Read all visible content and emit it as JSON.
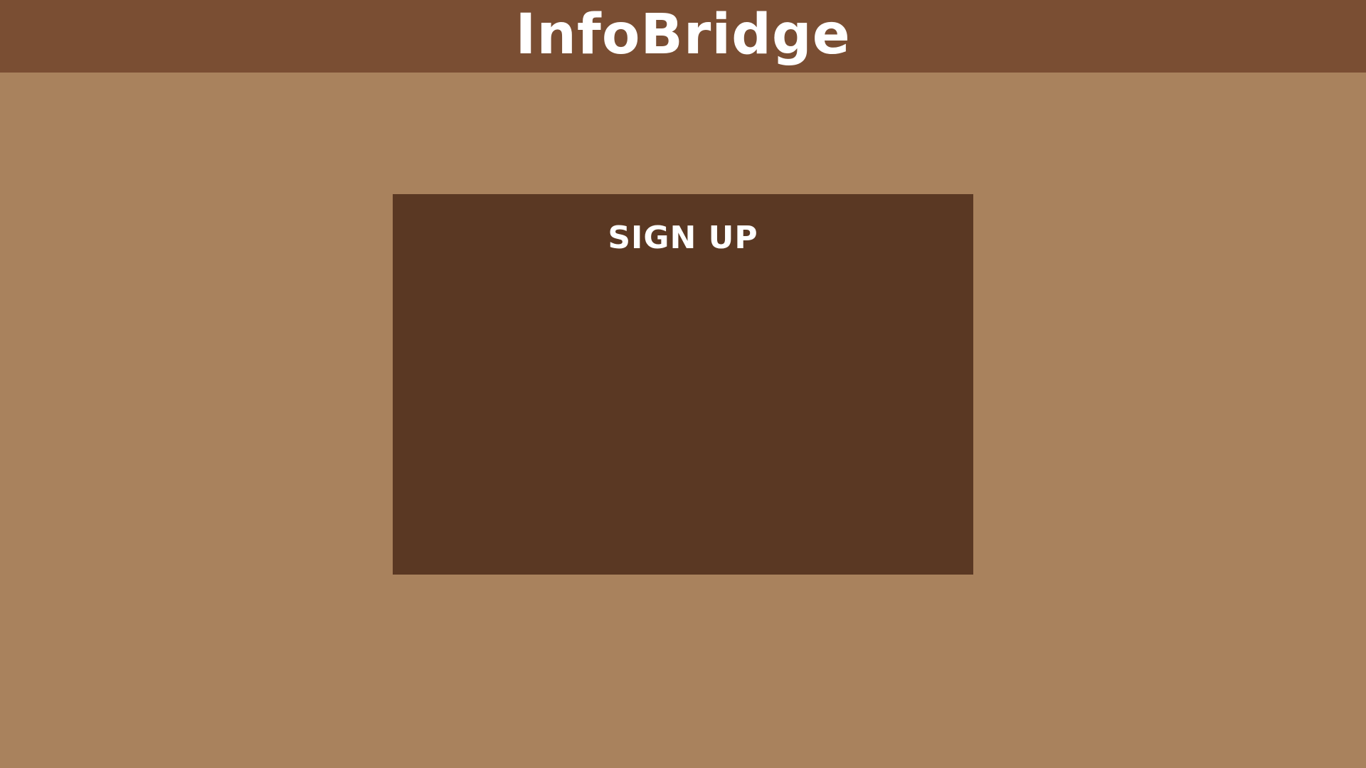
{
  "header": {
    "app_title": "InfoBridge"
  },
  "signup": {
    "title": "SIGN UP"
  },
  "colors": {
    "header_bg": "#7a4e33",
    "page_bg": "#a9825d",
    "panel_bg": "#5a3823",
    "text": "#ffffff"
  }
}
